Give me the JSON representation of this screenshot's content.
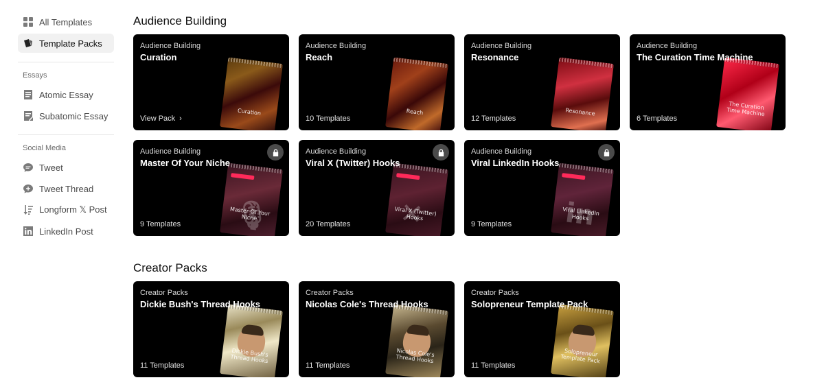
{
  "sidebar": {
    "top_items": [
      {
        "label": "All Templates",
        "icon": "grid-icon",
        "active": false
      },
      {
        "label": "Template Packs",
        "icon": "packs-icon",
        "active": true
      }
    ],
    "essays_label": "Essays",
    "essays": [
      {
        "label": "Atomic Essay",
        "icon": "document-icon"
      },
      {
        "label": "Subatomic Essay",
        "icon": "document-edit-icon"
      }
    ],
    "social_label": "Social Media",
    "social": [
      {
        "label": "Tweet",
        "icon": "chat-bubble-icon"
      },
      {
        "label": "Tweet Thread",
        "icon": "chat-thread-icon"
      },
      {
        "label": "Longform 𝕏 Post",
        "icon": "sort-icon"
      },
      {
        "label": "LinkedIn Post",
        "icon": "linkedin-icon"
      }
    ]
  },
  "sections": [
    {
      "title": "Audience Building",
      "cards": [
        {
          "category": "Audience Building",
          "title": "Curation",
          "footer": "View Pack",
          "locked": false,
          "pack_text": "Curation",
          "style": "p-curation"
        },
        {
          "category": "Audience Building",
          "title": "Reach",
          "footer": "10 Templates",
          "locked": false,
          "pack_text": "Reach",
          "style": "p-reach"
        },
        {
          "category": "Audience Building",
          "title": "Resonance",
          "footer": "12 Templates",
          "locked": false,
          "pack_text": "Resonance",
          "style": "p-resonance"
        },
        {
          "category": "Audience Building",
          "title": "The Curation Time Machine",
          "footer": "6 Templates",
          "locked": false,
          "pack_text": "The Curation Time Machine",
          "style": "p-time"
        },
        {
          "category": "Audience Building",
          "title": "Master Of Your Niche",
          "footer": "9 Templates",
          "locked": true,
          "pack_text": "Master Of Your Niche",
          "style": "p-niche"
        },
        {
          "category": "Audience Building",
          "title": "Viral X (Twitter) Hooks",
          "footer": "20 Templates",
          "locked": true,
          "pack_text": "Viral X (Twitter) Hooks",
          "style": "p-viralx"
        },
        {
          "category": "Audience Building",
          "title": "Viral LinkedIn Hooks",
          "footer": "9 Templates",
          "locked": true,
          "pack_text": "Viral LinkedIn Hooks",
          "style": "p-linkedin"
        }
      ]
    },
    {
      "title": "Creator Packs",
      "cards": [
        {
          "category": "Creator Packs",
          "title": "Dickie Bush's Thread Hooks",
          "footer": "11 Templates",
          "locked": false,
          "pack_text": "Dickie Bush's Thread Hooks",
          "style": "p-dickie"
        },
        {
          "category": "Creator Packs",
          "title": "Nicolas Cole's Thread Hooks",
          "footer": "11 Templates",
          "locked": false,
          "pack_text": "Nicolas Cole's Thread Hooks",
          "style": "p-nicolas"
        },
        {
          "category": "Creator Packs",
          "title": "Solopreneur Template Pack",
          "footer": "11 Templates",
          "locked": false,
          "pack_text": "Solopreneur Template Pack",
          "style": "p-solo"
        }
      ]
    }
  ]
}
